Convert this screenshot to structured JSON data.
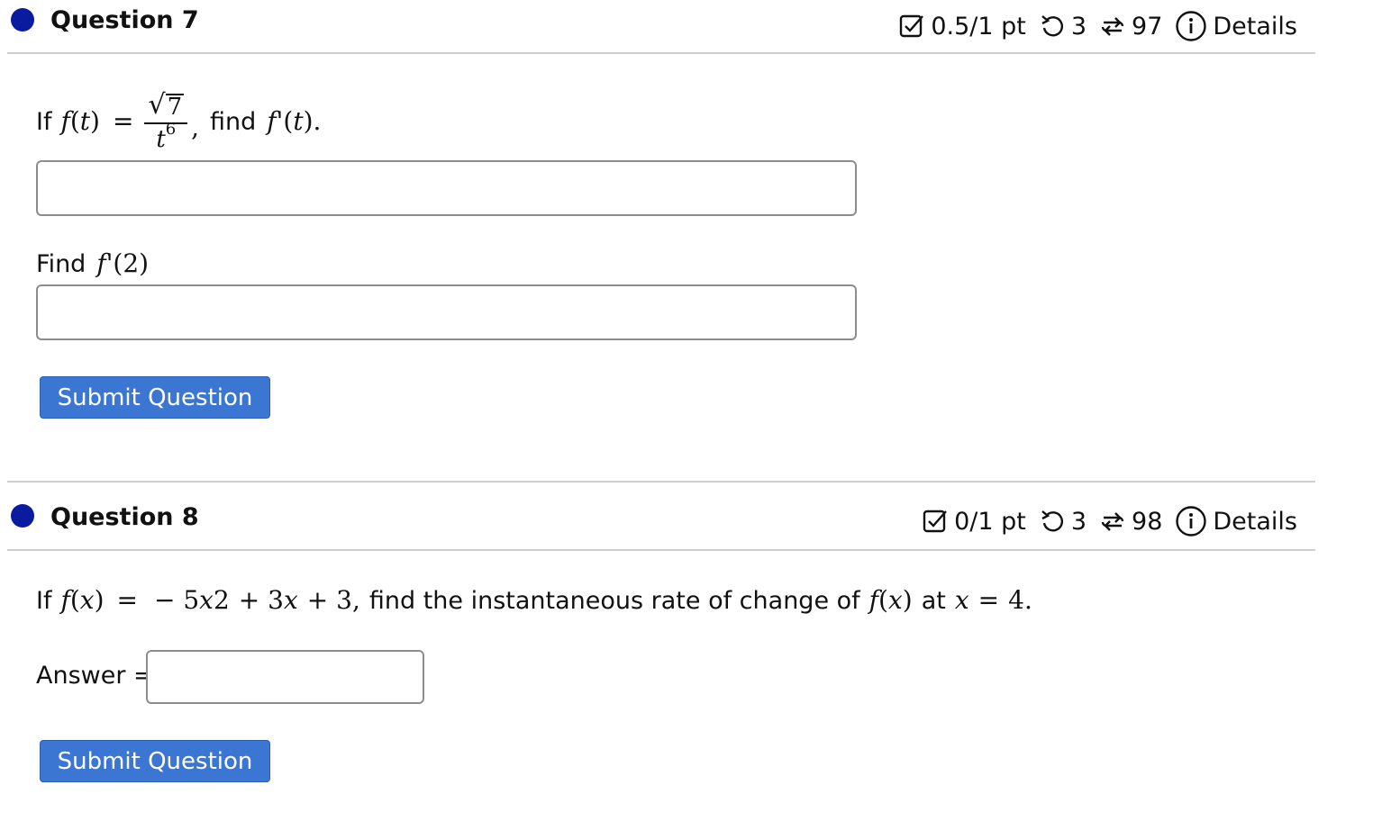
{
  "colors": {
    "dot": "#0b1ba0",
    "button_bg": "#3b76d3",
    "button_text": "#ffffff",
    "rule": "#cfcfcf"
  },
  "questions": [
    {
      "title": "Question 7",
      "score": "0.5/1 pt",
      "retries": "3",
      "attempts": "97",
      "details_label": "Details",
      "icons": [
        "checkbox-icon",
        "retry-icon",
        "attempts-icon",
        "info-icon"
      ],
      "text": {
        "if": "If",
        "fn": "f",
        "var_open": "(",
        "var": "t",
        "var_close": ")",
        "equals": "=",
        "sqrt_val": "7",
        "den_base": "t",
        "den_exp": "6",
        "comma": ",",
        "find": "find",
        "fprime": "f",
        "prime": "'",
        "tail_open": "(",
        "tail_var": "t",
        "tail_close": ").",
        "find2_label": "Find",
        "find2_fn": "f",
        "find2_prime": "'",
        "find2_arg": "(2)"
      },
      "inputs": [
        {
          "value": "",
          "placeholder": ""
        },
        {
          "value": "",
          "placeholder": ""
        }
      ],
      "submit_label": "Submit Question"
    },
    {
      "title": "Question 8",
      "score": "0/1 pt",
      "retries": "3",
      "attempts": "98",
      "details_label": "Details",
      "icons": [
        "checkbox-icon",
        "retry-icon",
        "attempts-icon",
        "info-icon"
      ],
      "text": {
        "if": "If",
        "fn": "f",
        "var_open": "(",
        "var": "x",
        "var_close": ")",
        "equals": "=",
        "expr_a": "− 5",
        "expr_x": "x",
        "expr_exp": "2",
        "expr_b": "+ 3",
        "expr_x2": "x",
        "expr_c": "+ 3,",
        "mid": "find the instantaneous rate of change of",
        "fn2": "f",
        "var2_open": "(",
        "var2": "x",
        "var2_close": ")",
        "at": "at",
        "at_var": "x",
        "at_eq": "=",
        "at_val": "4."
      },
      "answer_label": "Answer =",
      "input": {
        "value": "",
        "placeholder": ""
      },
      "submit_label": "Submit Question"
    }
  ]
}
